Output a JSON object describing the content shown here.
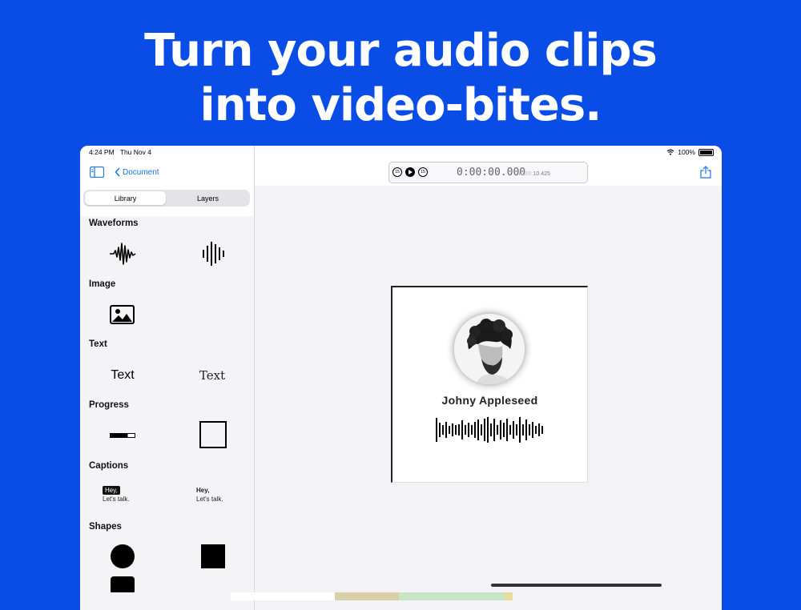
{
  "headline": {
    "line1": "Turn your audio clips",
    "line2": "into video-bites."
  },
  "status_bar": {
    "time": "4:24 PM",
    "date": "Thu Nov 4",
    "battery": "100%"
  },
  "sidebar": {
    "back_label": "Document",
    "segments": [
      "Library",
      "Layers"
    ],
    "sections": {
      "waveforms": "Waveforms",
      "image": "Image",
      "text": "Text",
      "progress": "Progress",
      "captions": "Captions",
      "shapes": "Shapes"
    },
    "text_tiles": [
      "Text",
      "Text"
    ],
    "caption_tiles": [
      {
        "line1": "Hey,",
        "line2": "Let's talk."
      },
      {
        "line1": "Hey,",
        "line2": "Let's talk."
      }
    ]
  },
  "transport": {
    "current": "0:00:00.000",
    "duration_prefix": "/",
    "duration_faded": "0:00:",
    "duration_value": "10.425",
    "skip_label": "15"
  },
  "canvas": {
    "name": "Johny Appleseed"
  },
  "colors": {
    "background": "#0a4de6",
    "accent": "#1a73e8"
  }
}
